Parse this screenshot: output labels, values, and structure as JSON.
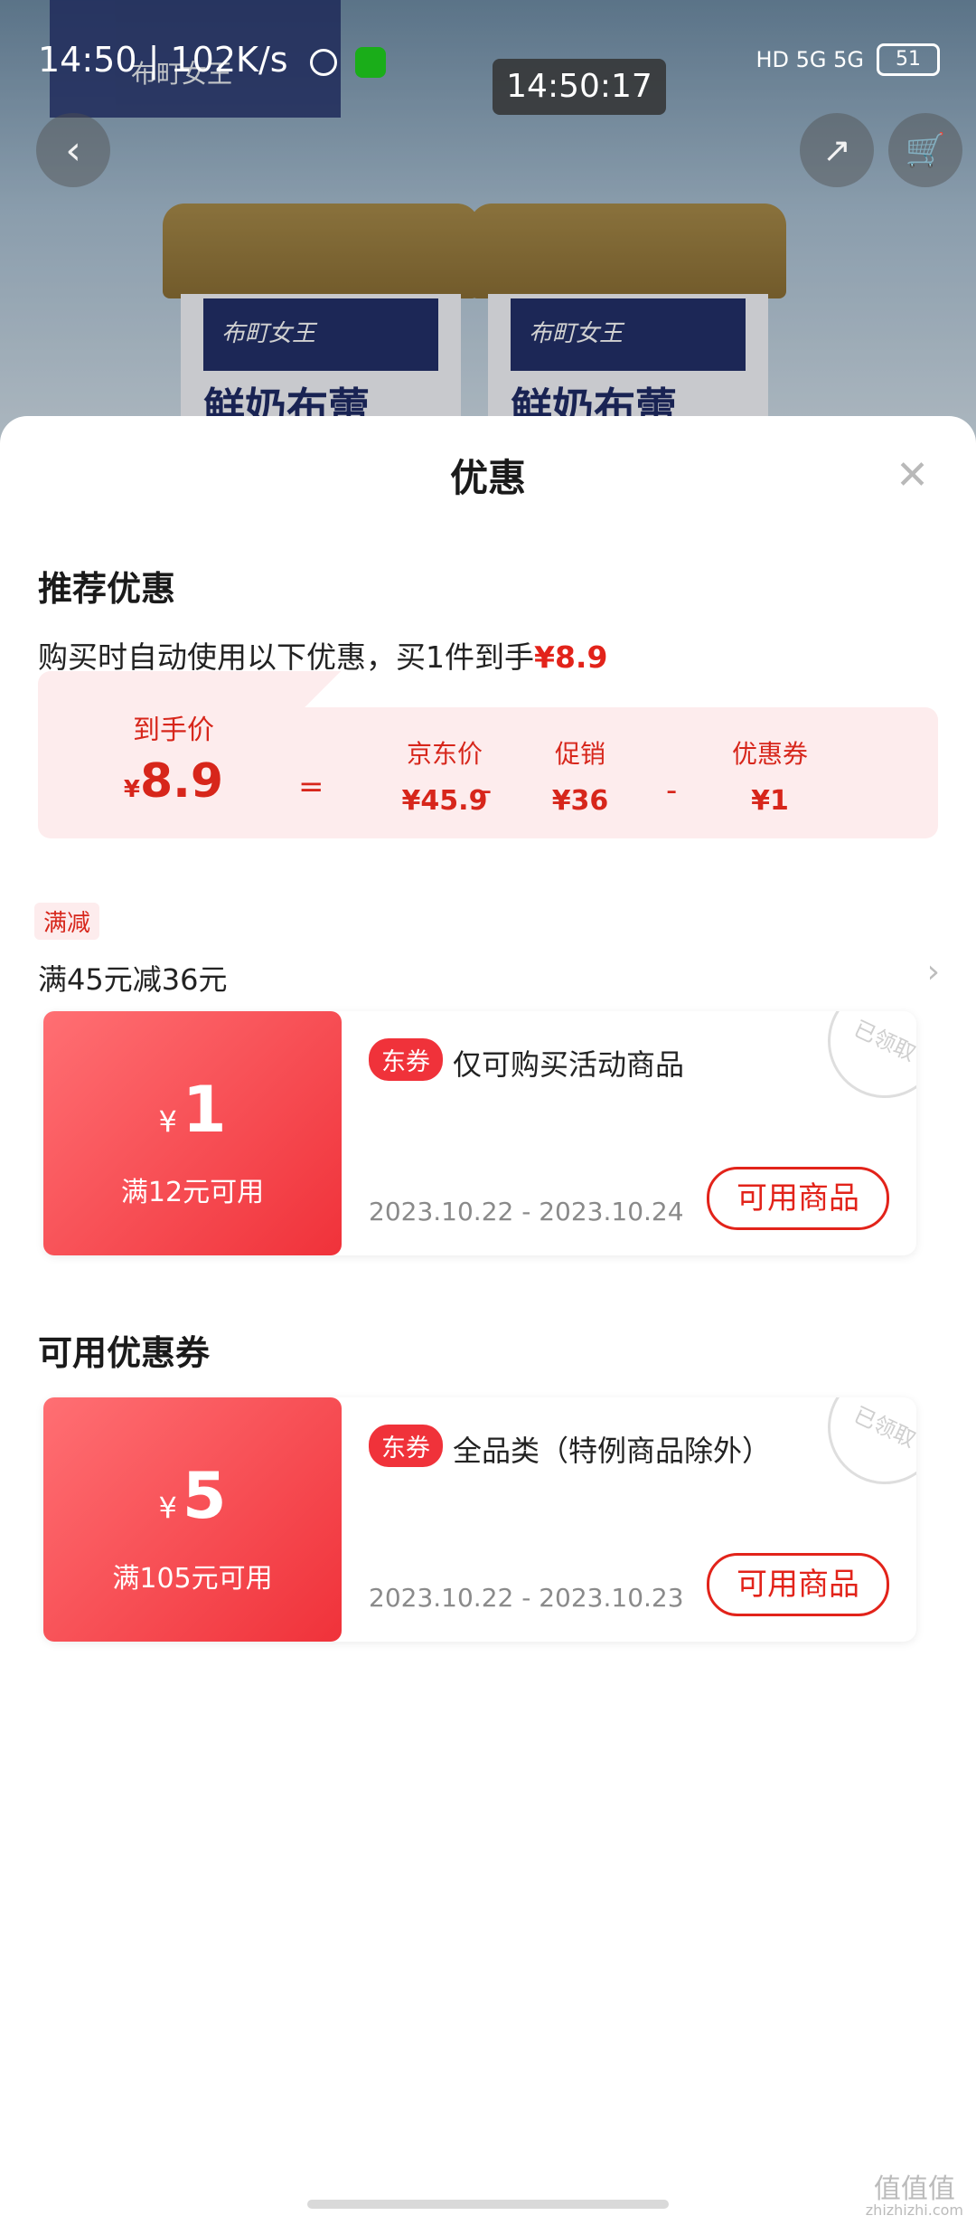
{
  "status_bar": {
    "time": "14:50",
    "net_speed": "| 102K/s",
    "overlay_time": "14:50:17",
    "network": "HD 5G 5G",
    "battery": "51"
  },
  "product": {
    "brand": "布町女王",
    "name": "鲜奶布蕾"
  },
  "sheet": {
    "title": "优惠",
    "recommended_heading": "推荐优惠",
    "hint_text": "购买时自动使用以下优惠，买1件到手",
    "hint_price": "¥8.9",
    "breakdown": {
      "final_label": "到手价",
      "final_currency": "¥",
      "final_value": "8.9",
      "eq": "=",
      "jd_label": "京东价",
      "jd_value": "¥45.9",
      "promo_label": "促销",
      "promo_value": "¥36",
      "coupon_label": "优惠券",
      "coupon_value": "¥1",
      "minus": "-"
    },
    "promo_tag": "满减",
    "promo_rule": "满45元减36元",
    "available_heading": "可用优惠券",
    "coupons": [
      {
        "currency": "¥",
        "amount": "1",
        "condition": "满12元可用",
        "badge": "东券",
        "desc": "仅可购买活动商品",
        "dates": "2023.10.22 - 2023.10.24",
        "button": "可用商品",
        "stamp": "已领取"
      },
      {
        "currency": "¥",
        "amount": "5",
        "condition": "满105元可用",
        "badge": "东券",
        "desc": "全品类（特例商品除外）",
        "dates": "2023.10.22 - 2023.10.23",
        "button": "可用商品",
        "stamp": "已领取"
      }
    ]
  },
  "watermark": {
    "main": "值值值",
    "sub": "zhizhizhi.com"
  }
}
